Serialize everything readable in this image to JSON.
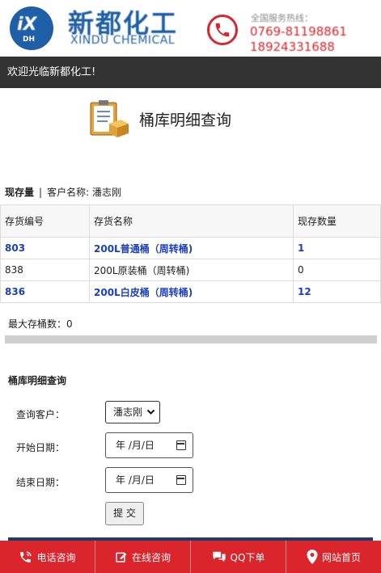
{
  "header": {
    "logo_badge_text": "iX",
    "logo_badge_sub": "DH",
    "logo_cn": "新都化工",
    "logo_en": "XINDU CHEMICAL",
    "hotline_label": "全国服务热线：",
    "phone_1": "0769-81198861",
    "phone_2": "18924331688",
    "brand_color": "#1f5fa8",
    "accent_color": "#d9252b"
  },
  "welcome": "欢迎光临新都化工!",
  "page_title": "桶库明细查询",
  "summary": {
    "section": "现存量",
    "separator": "|",
    "customer_label": "客户名称:",
    "customer_name": "潘志刚"
  },
  "stock_table": {
    "headers": [
      "存货编号",
      "存货名称",
      "现存数量"
    ],
    "rows": [
      {
        "code": "803",
        "name": "200L普通桶（周转桶)",
        "qty": "1"
      },
      {
        "code": "838",
        "name": "200L原装桶（周转桶)",
        "qty": "0"
      },
      {
        "code": "836",
        "name": "200L白皮桶（周转桶)",
        "qty": "12"
      }
    ]
  },
  "max_count": "最大存桶数：0",
  "query_form": {
    "title": "桶库明细查询",
    "customer_label": "查询客户：",
    "customer_value": "潘志刚",
    "start_label": "开始日期：",
    "end_label": "结束日期：",
    "date_placeholder": "年 /月/日",
    "submit_label": "提 交"
  },
  "bottom_nav": [
    {
      "label": "电话咨询",
      "icon": "phone-icon"
    },
    {
      "label": "在线咨询",
      "icon": "edit-icon"
    },
    {
      "label": "QQ下单",
      "icon": "chat-icon"
    },
    {
      "label": "网站首页",
      "icon": "location-pin-icon"
    }
  ]
}
